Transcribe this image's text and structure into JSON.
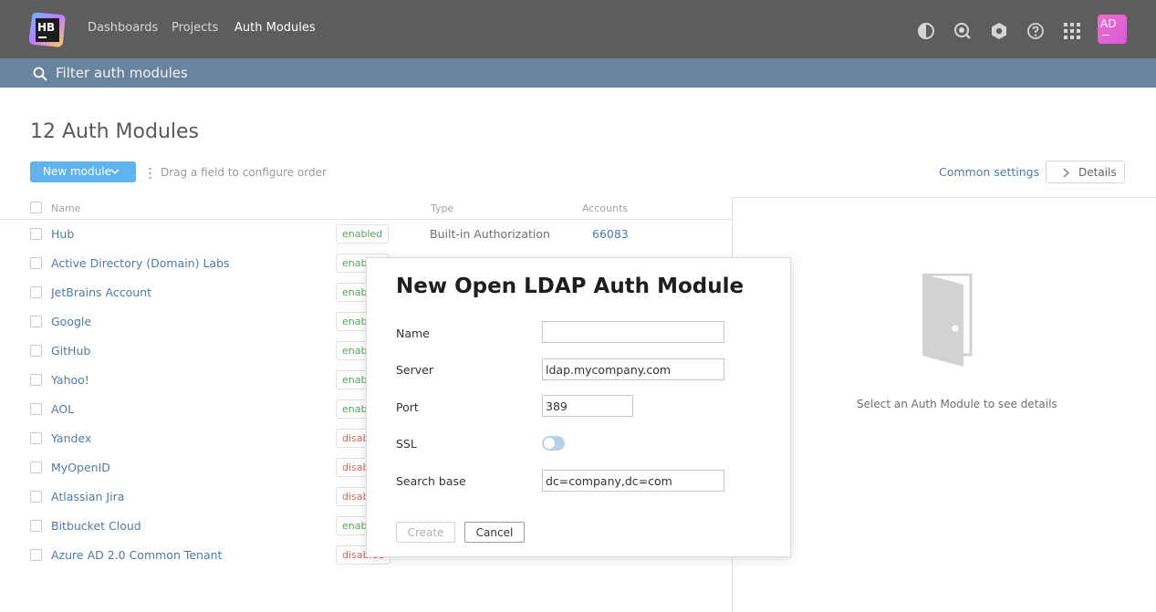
{
  "header": {
    "logo_text": "HB",
    "nav": [
      {
        "label": "Dashboards"
      },
      {
        "label": "Projects"
      },
      {
        "label": "Auth Modules",
        "active": true
      }
    ],
    "icons": [
      "contrast-icon",
      "search-icon",
      "settings-icon",
      "help-icon",
      "apps-grid-icon"
    ],
    "avatar_initials": "AD"
  },
  "filter": {
    "placeholder": "Filter auth modules"
  },
  "page": {
    "title": "12 Auth Modules",
    "new_module_label": "New module",
    "drag_hint": "Drag a field to configure order",
    "common_settings_label": "Common settings",
    "details_label": "Details"
  },
  "table": {
    "columns": {
      "name": "Name",
      "type": "Type",
      "accounts": "Accounts"
    },
    "rows": [
      {
        "name": "Hub",
        "status": "enabled",
        "type": "Built-in Authorization",
        "accounts": "66083"
      },
      {
        "name": "Active Directory (Domain) Labs",
        "status": "enabled",
        "type": "",
        "accounts": ""
      },
      {
        "name": "JetBrains Account",
        "status": "enabled",
        "type": "",
        "accounts": ""
      },
      {
        "name": "Google",
        "status": "enabled",
        "type": "",
        "accounts": ""
      },
      {
        "name": "GitHub",
        "status": "enabled",
        "type": "",
        "accounts": ""
      },
      {
        "name": "Yahoo!",
        "status": "enabled",
        "type": "",
        "accounts": ""
      },
      {
        "name": "AOL",
        "status": "enabled",
        "type": "",
        "accounts": ""
      },
      {
        "name": "Yandex",
        "status": "disabled",
        "type": "",
        "accounts": ""
      },
      {
        "name": "MyOpenID",
        "status": "disabled",
        "type": "",
        "accounts": ""
      },
      {
        "name": "Atlassian Jira",
        "status": "disabled",
        "type": "",
        "accounts": ""
      },
      {
        "name": "Bitbucket Cloud",
        "status": "enabled",
        "type": "",
        "accounts": ""
      },
      {
        "name": "Azure AD 2.0 Common Tenant",
        "status": "disabled",
        "type": "",
        "accounts": ""
      }
    ]
  },
  "details_panel": {
    "empty_text": "Select an Auth Module to see details"
  },
  "dialog": {
    "title": "New Open LDAP Auth Module",
    "fields": {
      "name": {
        "label": "Name",
        "value": ""
      },
      "server": {
        "label": "Server",
        "value": "ldap.mycompany.com"
      },
      "port": {
        "label": "Port",
        "value": "389"
      },
      "ssl": {
        "label": "SSL",
        "enabled": false
      },
      "search_base": {
        "label": "Search base",
        "value": "dc=company,dc=com"
      }
    },
    "create_label": "Create",
    "cancel_label": "Cancel"
  },
  "colors": {
    "header_bg": "#5d5d5d",
    "filter_bg": "#6b849d",
    "link": "#4e7ba6",
    "primary_button": "#5fb3ef",
    "enabled": "#59a65b",
    "disabled": "#d8696a"
  }
}
